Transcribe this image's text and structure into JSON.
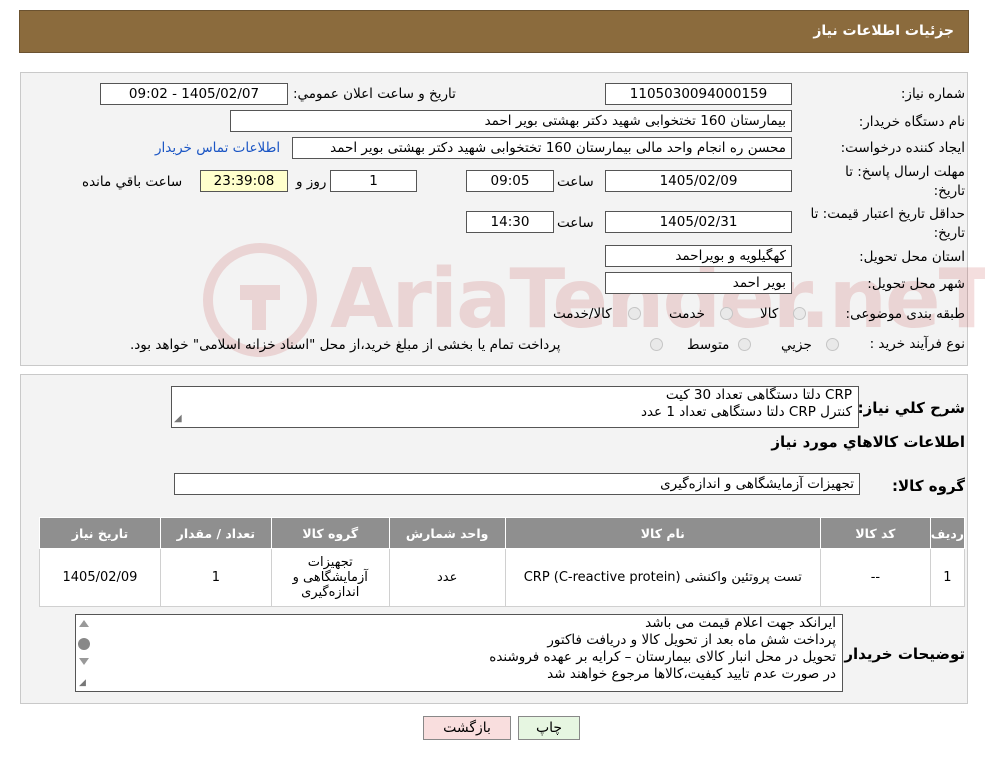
{
  "header": {
    "title": "جزئیات اطلاعات نیاز"
  },
  "form": {
    "need_number_label": "شماره نیاز:",
    "need_number": "1105030094000159",
    "announce_label": "تاریخ و ساعت اعلان عمومي:",
    "announce_value": "1405/02/07 - 09:02",
    "buyer_org_label": "نام دستگاه خريدار:",
    "buyer_org": "بیمارستان 160 تختخوابی شهید دکتر بهشتی بویر احمد",
    "creator_label": "ایجاد کننده درخواست:",
    "creator": "محسن ره انجام واحد مالی بیمارستان 160 تختخوابی شهید دکتر بهشتی بویر احمد",
    "contact_link": "اطلاعات تماس خريدار",
    "deadline_label_1": "مهلت ارسال پاسخ: تا",
    "deadline_label_2": "تاریخ:",
    "deadline_date": "1405/02/09",
    "time_label": "ساعت",
    "deadline_time": "09:05",
    "days_value": "1",
    "days_label": "روز و",
    "remaining_time": "23:39:08",
    "remaining_label": "ساعت باقي مانده",
    "validity_label_1": "حداقل تاریخ اعتبار قیمت: تا",
    "validity_label_2": "تاریخ:",
    "validity_date": "1405/02/31",
    "validity_time": "14:30",
    "province_label": "استان محل تحويل:",
    "province": "کهگیلویه و بویراحمد",
    "city_label": "شهر محل تحويل:",
    "city": "بویر احمد",
    "category_label": "طبقه بندی موضوعی:",
    "category_options": [
      "کالا",
      "خدمت",
      "کالا/خدمت"
    ],
    "purchase_type_label": "نوع فرآیند خرید :",
    "purchase_options": [
      "جزیي",
      "متوسط"
    ],
    "purchase_note": "پرداخت تمام یا بخشی از مبلغ خرید،از محل \"اسناد خزانه اسلامی\" خواهد بود."
  },
  "watermark": {
    "text": "AriaTender.neT"
  },
  "summary": {
    "label": "شرح کلي نياز:",
    "lines": [
      "CRP دلتا دستگاهی تعداد 30 کیت",
      "کنترل  CRP  دلتا دستگاهی تعداد 1 عدد"
    ]
  },
  "items_section": {
    "title": "اطلاعات کالاهاي مورد نياز",
    "group_label": "گروه کالا:",
    "group_value": "تجهیزات آزمایشگاهی و اندازه‌گیری"
  },
  "table": {
    "headers": [
      "رديف",
      "کد کالا",
      "نام کالا",
      "واحد شمارش",
      "گروه کالا",
      "تعداد / مقدار",
      "تاريخ نياز"
    ],
    "rows": [
      [
        "1",
        "--",
        "تست پروتئین واکنشی CRP (C-reactive protein)",
        "عدد",
        "تجهیزات آزمایشگاهی و اندازه‌گیری",
        "1",
        "1405/02/09"
      ]
    ]
  },
  "buyer_notes": {
    "label": "توضیحات خریدار:",
    "lines": [
      "ایرانکد جهت اعلام قیمت می باشد",
      "پرداخت شش ماه بعد از تحویل کالا و دریافت فاکتور",
      "تحویل در محل انبار کالای بیمارستان – کرایه بر عهده فروشنده",
      "در صورت عدم تایید کیفیت،کالاها مرجوع خواهند شد"
    ]
  },
  "buttons": {
    "print": "چاپ",
    "back": "بازگشت"
  },
  "colors": {
    "header_bg": "#8b6b3d",
    "link": "#1a55c4",
    "back_button": "#f9dede",
    "print_button": "#e6f6e1",
    "table_header": "#8f8f8f"
  }
}
